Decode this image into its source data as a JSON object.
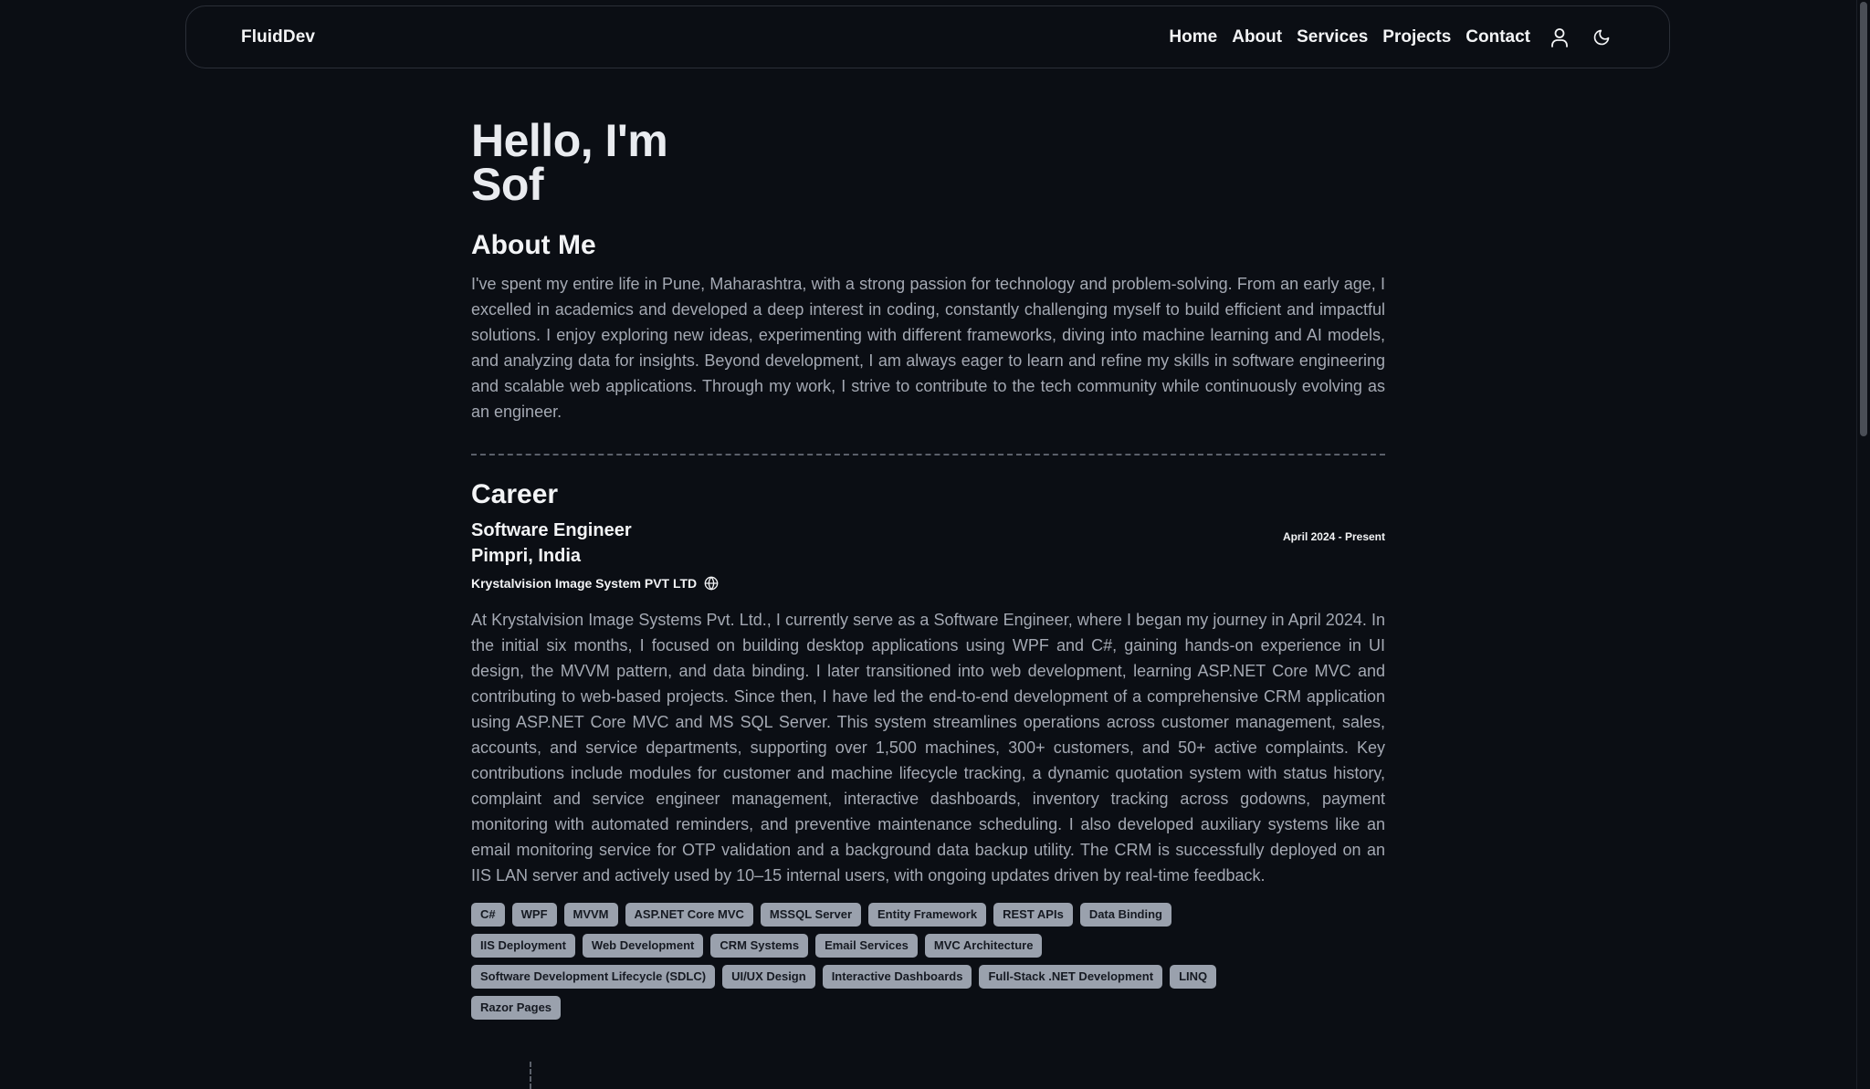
{
  "nav": {
    "brand": "FluidDev",
    "links": [
      "Home",
      "About",
      "Services",
      "Projects",
      "Contact"
    ],
    "icons": [
      "user-icon",
      "moon-icon"
    ]
  },
  "hero": {
    "line1": "Hello, I'm",
    "line2": "Sof"
  },
  "about": {
    "heading": "About Me",
    "text": "I've spent my entire life in Pune, Maharashtra, with a strong passion for technology and problem-solving. From an early age, I excelled in academics and developed a deep interest in coding, constantly challenging myself to build efficient and impactful solutions. I enjoy exploring new ideas, experimenting with different frameworks, diving into machine learning and AI models, and analyzing data for insights. Beyond development, I am always eager to learn and refine my skills in software engineering and scalable web applications. Through my work, I strive to contribute to the tech community while continuously evolving as an engineer."
  },
  "career": {
    "heading": "Career",
    "job": {
      "title": "Software Engineer",
      "location": "Pimpri, India",
      "date": "April 2024 - Present",
      "company": "Krystalvision Image System PVT LTD",
      "description": "At Krystalvision Image Systems Pvt. Ltd., I currently serve as a Software Engineer, where I began my journey in April 2024. In the initial six months, I focused on building desktop applications using WPF and C#, gaining hands-on experience in UI design, the MVVM pattern, and data binding. I later transitioned into web development, learning ASP.NET Core MVC and contributing to web-based projects. Since then, I have led the end-to-end development of a comprehensive CRM application using ASP.NET Core MVC and MS SQL Server. This system streamlines operations across customer management, sales, accounts, and service departments, supporting over 1,500 machines, 300+ customers, and 50+ active complaints. Key contributions include modules for customer and machine lifecycle tracking, a dynamic quotation system with status history, complaint and service engineer management, interactive dashboards, inventory tracking across godowns, payment monitoring with automated reminders, and preventive maintenance scheduling. I also developed auxiliary systems like an email monitoring service for OTP validation and a background data backup utility. The CRM is successfully deployed on an IIS LAN server and actively used by 10–15 internal users, with ongoing updates driven by real-time feedback.",
      "tags": [
        "C#",
        "WPF",
        "MVVM",
        "ASP.NET Core MVC",
        "MSSQL Server",
        "Entity Framework",
        "REST APIs",
        "Data Binding",
        "IIS Deployment",
        "Web Development",
        "CRM Systems",
        "Email Services",
        "MVC Architecture",
        "Software Development Lifecycle (SDLC)",
        "UI/UX Design",
        "Interactive Dashboards",
        "Full-Stack .NET Development",
        "LINQ",
        "Razor Pages"
      ]
    }
  },
  "colors": {
    "background": "#0b0e14",
    "tag_background": "#9aa1ad",
    "muted_text": "#a4a9b3"
  }
}
